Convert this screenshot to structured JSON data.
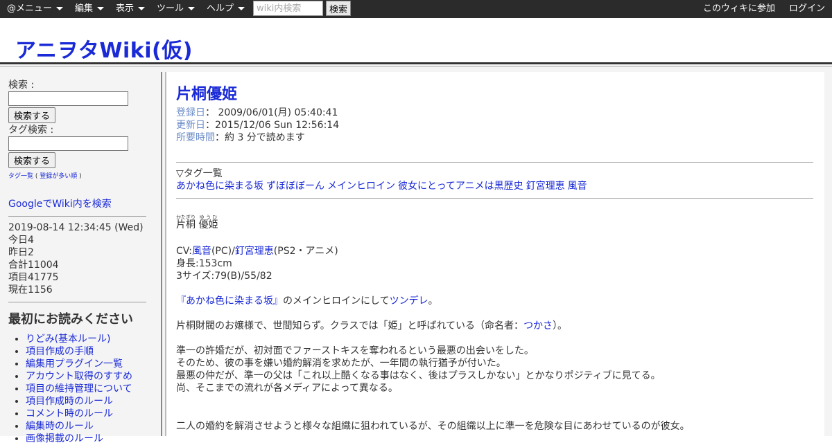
{
  "topbar": {
    "menus": [
      "@メニュー",
      "編集",
      "表示",
      "ツール",
      "ヘルプ"
    ],
    "search_placeholder": "wiki内検索",
    "search_button": "検索",
    "join": "このウィキに参加",
    "login": "ログイン"
  },
  "header": {
    "title": "アニヲタWiki(仮)"
  },
  "sidebar": {
    "search_label": "検索 :",
    "search_button": "検索する",
    "tag_search_label": "タグ検索 :",
    "tag_search_button": "検索する",
    "tag_list": "タグ一覧",
    "tag_popular": "登録が多い順",
    "google_search": "GoogleでWiki内を検索",
    "datetime": "2019-08-14 12:34:45 (Wed)",
    "stats": [
      "今日4",
      "昨日2",
      "合計11004",
      "項目41775",
      "現在1156"
    ],
    "read_first": "最初にお読みください",
    "rules": [
      "りどみ(基本ルール)",
      "項目作成の手順",
      "編集用プラグイン一覧",
      "アカウント取得のすすめ",
      "項目の維持管理について",
      "項目作成時のルール",
      "コメント時のルール",
      "編集時のルール",
      "画像掲載のルール"
    ]
  },
  "article": {
    "title": "片桐優姫",
    "meta": {
      "created_key": "登録日",
      "created_val": "：  2009/06/01(月) 05:40:41",
      "updated_key": "更新日",
      "updated_val": "：2015/12/06 Sun 12:56:14",
      "read_key": "所要時間",
      "read_val": "：約 3 分で読めます"
    },
    "tags_label": "▽タグ一覧",
    "tags": [
      "あかね色に染まる坂",
      "ずぼぼぼーん",
      "メインヒロイン",
      "彼女にとってアニメは黒歴史",
      "釘宮理恵",
      "風音"
    ],
    "name_surname": "片桐",
    "name_surname_ruby": "かたぎり",
    "name_given": "優姫",
    "name_given_ruby": "ゆうひ",
    "cv_prefix": "CV:",
    "cv_1": "風音",
    "cv_mid": "(PC)/",
    "cv_2": "釘宮理恵",
    "cv_suffix": "(PS2・アニメ)",
    "height": "身長:153cm",
    "sizes": "3サイズ:79(B)/55/82",
    "intro_link": "『あかね色に染まる坂』",
    "intro_mid": "のメインヒロインにして",
    "intro_link2": "ツンデレ",
    "intro_end": "。",
    "line_family_pre": "片桐財閥のお嬢様で、世間知らず。クラスでは「姫」と呼ばれている（命名者：",
    "line_family_link": "つかさ",
    "line_family_post": "）。",
    "p1": "準一の許婚だが、初対面でファーストキスを奪われるという最悪の出会いをした。",
    "p2": "そのため、彼の事を嫌い婚約解消を求めたが、一年間の執行猶予が付いた。",
    "p3": "最悪の仲だが、準一の父は「これ以上酷くなる事はなく、後はプラスしかない」とかなりポジティブに見てる。",
    "p4": "尚、そこまでの流れが各メディアによって異なる。",
    "p5": "二人の婚約を解消させようと様々な組織に狙われているが、その組織以上に準一を危険な目にあわせているのが彼女。"
  },
  "colors": {
    "link": "#1a2ad6",
    "topbar": "#2b2b2b",
    "meta_key": "#6b8cc9"
  }
}
